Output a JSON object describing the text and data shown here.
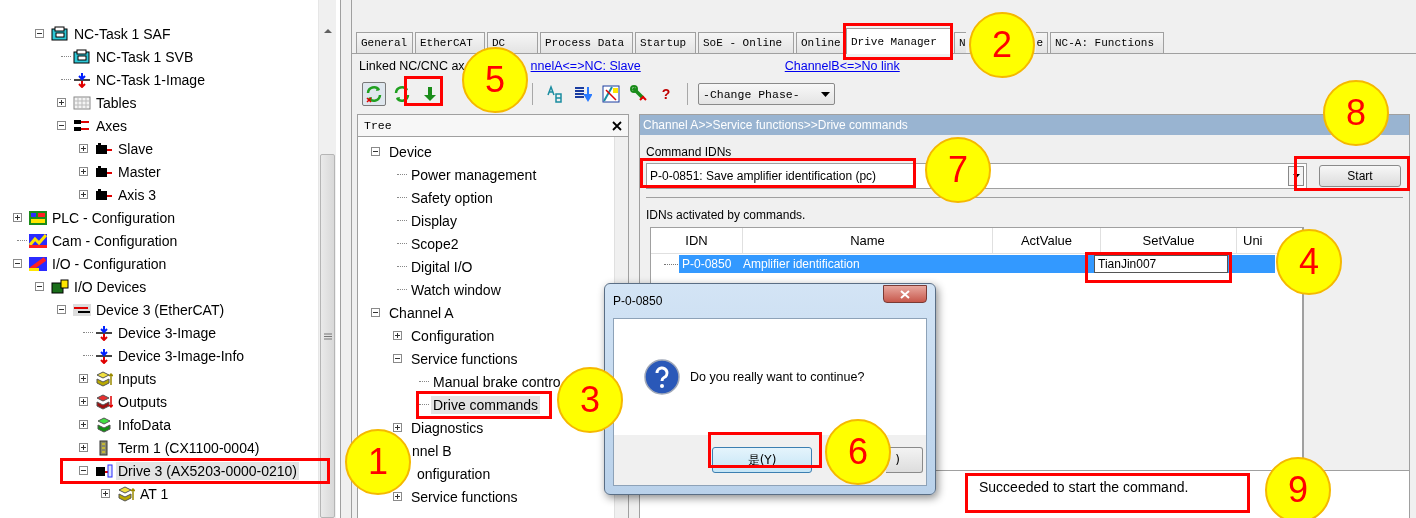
{
  "left_tree": {
    "items": [
      {
        "children": [
          {
            "label": "NC-Task 1 SAF",
            "kind": "task",
            "expanded": true,
            "selected": false,
            "children": [
              {
                "label": "NC-Task 1 SVB",
                "kind": "task",
                "selected": false
              },
              {
                "label": "NC-Task 1-Image",
                "kind": "image",
                "selected": false
              },
              {
                "label": "Tables",
                "kind": "table",
                "expanded": false,
                "selected": false
              },
              {
                "label": "Axes",
                "kind": "axes",
                "expanded": true,
                "selected": false,
                "children": [
                  {
                    "label": "Slave",
                    "kind": "axis",
                    "expanded": false,
                    "selected": false
                  },
                  {
                    "label": "Master",
                    "kind": "axis",
                    "expanded": false,
                    "selected": false
                  },
                  {
                    "label": "Axis 3",
                    "kind": "axis",
                    "expanded": false,
                    "selected": false
                  }
                ]
              }
            ]
          }
        ]
      },
      {
        "label": "PLC - Configuration",
        "kind": "plc",
        "expanded": false,
        "selected": false
      },
      {
        "label": "Cam - Configuration",
        "kind": "cam",
        "selected": false
      },
      {
        "label": "I/O - Configuration",
        "kind": "io",
        "expanded": true,
        "selected": false,
        "children": [
          {
            "label": "I/O Devices",
            "kind": "devices",
            "expanded": true,
            "selected": false,
            "children": [
              {
                "label": "Device 3 (EtherCAT)",
                "kind": "ethercat",
                "expanded": true,
                "selected": false,
                "children": [
                  {
                    "label": "Device 3-Image",
                    "kind": "image",
                    "selected": false
                  },
                  {
                    "label": "Device 3-Image-Info",
                    "kind": "image",
                    "selected": false
                  },
                  {
                    "label": "Inputs",
                    "kind": "inputs",
                    "expanded": false,
                    "selected": false
                  },
                  {
                    "label": "Outputs",
                    "kind": "outputs",
                    "expanded": false,
                    "selected": false
                  },
                  {
                    "label": "InfoData",
                    "kind": "infodata",
                    "expanded": false,
                    "selected": false
                  },
                  {
                    "label": "Term 1 (CX1100-0004)",
                    "kind": "terminal",
                    "expanded": false,
                    "selected": false
                  },
                  {
                    "label": "Drive 3 (AX5203-0000-0210)",
                    "kind": "drive",
                    "expanded": true,
                    "selected": true,
                    "children": [
                      {
                        "label": "AT 1",
                        "kind": "inputs",
                        "expanded": false,
                        "selected": false
                      }
                    ]
                  }
                ]
              }
            ]
          }
        ]
      }
    ]
  },
  "tabs": [
    {
      "label_parts": [
        "General"
      ],
      "selected": false
    },
    {
      "label_parts": [
        "EtherCAT"
      ],
      "selected": false
    },
    {
      "label_parts": [
        "DC"
      ],
      "selected": false
    },
    {
      "label_parts": [
        "Process Data"
      ],
      "selected": false
    },
    {
      "label_parts": [
        "Startup"
      ],
      "selected": false
    },
    {
      "label_parts": [
        "SoE - Online"
      ],
      "selected": false
    },
    {
      "label_parts": [
        "Online"
      ],
      "selected": false
    },
    {
      "label_parts": [
        "Drive Manager"
      ],
      "selected": true
    },
    {
      "label_parts": [
        "N",
        "e"
      ],
      "selected": false
    },
    {
      "label_parts": [
        "NC-A: Functions"
      ],
      "selected": false
    }
  ],
  "link_row": {
    "label": "Linked NC/CNC ax",
    "channel_a_link": "nnelA<=>NC: Slave",
    "channel_b_link": "ChannelB<=>No link"
  },
  "toolbar": {
    "buttons": [
      {
        "kind": "sync",
        "pressed": true
      },
      {
        "kind": "refresh",
        "pressed": false
      },
      {
        "kind": "download",
        "pressed": false
      }
    ],
    "tools": [
      {
        "kind": "translate"
      },
      {
        "kind": "list-download"
      },
      {
        "kind": "chart"
      },
      {
        "kind": "wrench"
      }
    ],
    "help": "?",
    "phase_select": "-Change Phase-"
  },
  "tree_pane": {
    "title": "Tree",
    "items": [
      {
        "label": "Device",
        "expanded": true,
        "selected": false,
        "children": [
          {
            "label": "Power management",
            "selected": false
          },
          {
            "label": "Safety option",
            "selected": false
          },
          {
            "label": "Display",
            "selected": false
          },
          {
            "label": "Scope2",
            "selected": false
          },
          {
            "label": "Digital I/O",
            "selected": false
          },
          {
            "label": "Watch window",
            "selected": false
          }
        ]
      },
      {
        "label": "Channel A",
        "expanded": true,
        "selected": false,
        "children": [
          {
            "label": "Configuration",
            "expanded": false,
            "selected": false
          },
          {
            "label": "Service functions",
            "expanded": true,
            "selected": false,
            "children": [
              {
                "label": "Manual brake contro",
                "selected": false
              },
              {
                "label": "Drive commands",
                "selected": true
              }
            ]
          },
          {
            "label": "Diagnostics",
            "expanded": false,
            "selected": false
          }
        ]
      },
      {
        "label": "nnel B",
        "selected": false,
        "children": [
          {
            "label": "onfiguration",
            "selected": false
          },
          {
            "label": "Service functions",
            "expanded": false,
            "selected": false
          }
        ]
      }
    ]
  },
  "panel": {
    "breadcrumb": "Channel A>>Service functions>>Drive commands",
    "command_label": "Command IDNs",
    "command_value": "P-0-0851: Save amplifier identification (pc)",
    "start_button": "Start",
    "table_label": "IDNs activated by commands.",
    "columns": [
      "IDN",
      "Name",
      "ActValue",
      "SetValue",
      "Uni"
    ],
    "rows": [
      {
        "idn": "P-0-0850",
        "name": "Amplifier identification",
        "set_value": "TianJin007",
        "selected": true
      }
    ],
    "status": "Succeeded to start the command."
  },
  "dialog": {
    "title": "P-0-0850",
    "message": "Do you really want to continue?",
    "buttons": [
      {
        "label": "是(Y)",
        "focused": true
      },
      {
        "label": ")",
        "focused": false
      }
    ]
  },
  "annotations": [
    {
      "number": "1"
    },
    {
      "number": "2"
    },
    {
      "number": "3"
    },
    {
      "number": "4"
    },
    {
      "number": "5"
    },
    {
      "number": "6"
    },
    {
      "number": "7"
    },
    {
      "number": "8"
    },
    {
      "number": "9"
    }
  ]
}
